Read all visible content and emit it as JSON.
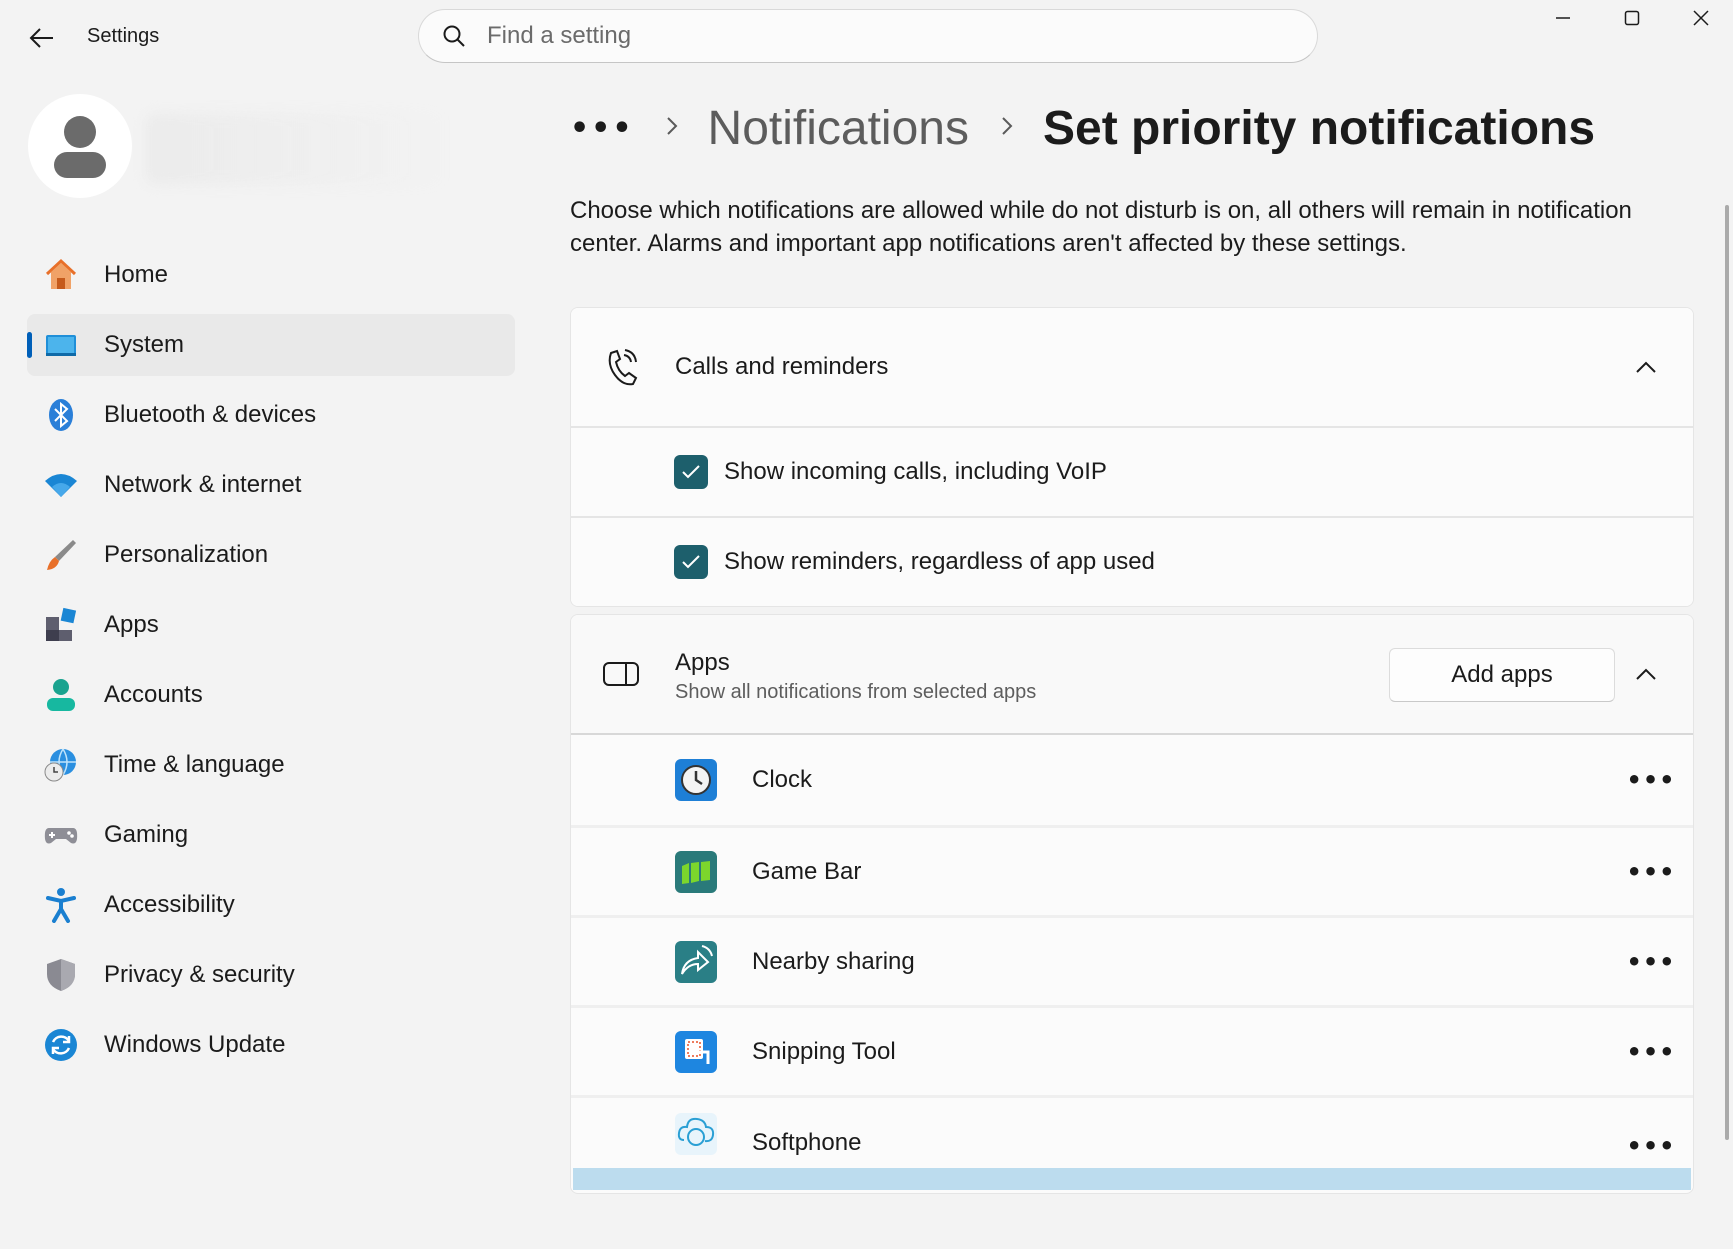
{
  "window": {
    "title": "Settings",
    "controls": {
      "minimize": "minimize",
      "maximize": "maximize",
      "close": "close"
    }
  },
  "search": {
    "placeholder": "Find a setting",
    "value": ""
  },
  "sidebar": {
    "items": [
      {
        "label": "Home",
        "icon": "home-icon",
        "selected": false
      },
      {
        "label": "System",
        "icon": "system-icon",
        "selected": true
      },
      {
        "label": "Bluetooth & devices",
        "icon": "bluetooth-icon",
        "selected": false
      },
      {
        "label": "Network & internet",
        "icon": "wifi-icon",
        "selected": false
      },
      {
        "label": "Personalization",
        "icon": "brush-icon",
        "selected": false
      },
      {
        "label": "Apps",
        "icon": "apps-icon",
        "selected": false
      },
      {
        "label": "Accounts",
        "icon": "accounts-icon",
        "selected": false
      },
      {
        "label": "Time & language",
        "icon": "globe-clock-icon",
        "selected": false
      },
      {
        "label": "Gaming",
        "icon": "gamepad-icon",
        "selected": false
      },
      {
        "label": "Accessibility",
        "icon": "accessibility-icon",
        "selected": false
      },
      {
        "label": "Privacy & security",
        "icon": "shield-icon",
        "selected": false
      },
      {
        "label": "Windows Update",
        "icon": "update-icon",
        "selected": false
      }
    ]
  },
  "breadcrumb": {
    "more": "•••",
    "parent": "Notifications",
    "current": "Set priority notifications"
  },
  "description": "Choose which notifications are allowed while do not disturb is on, all others will remain in notification center. Alarms and important app notifications aren't affected by these settings.",
  "calls_card": {
    "title": "Calls and reminders",
    "options": [
      {
        "label": "Show incoming calls, including VoIP",
        "checked": true
      },
      {
        "label": "Show reminders, regardless of app used",
        "checked": true
      }
    ]
  },
  "apps_card": {
    "title": "Apps",
    "subtitle": "Show all notifications from selected apps",
    "add_button": "Add apps",
    "apps": [
      {
        "name": "Clock",
        "icon": "clock-icon"
      },
      {
        "name": "Game Bar",
        "icon": "game-bar-icon"
      },
      {
        "name": "Nearby sharing",
        "icon": "nearby-sharing-icon"
      },
      {
        "name": "Snipping Tool",
        "icon": "snipping-tool-icon"
      },
      {
        "name": "Softphone",
        "icon": "softphone-icon"
      }
    ],
    "more_label": "•••"
  },
  "colors": {
    "accent": "#005fb8",
    "checkbox": "#1d5f6c",
    "background": "#f3f3f3",
    "card": "#fbfbfb"
  }
}
